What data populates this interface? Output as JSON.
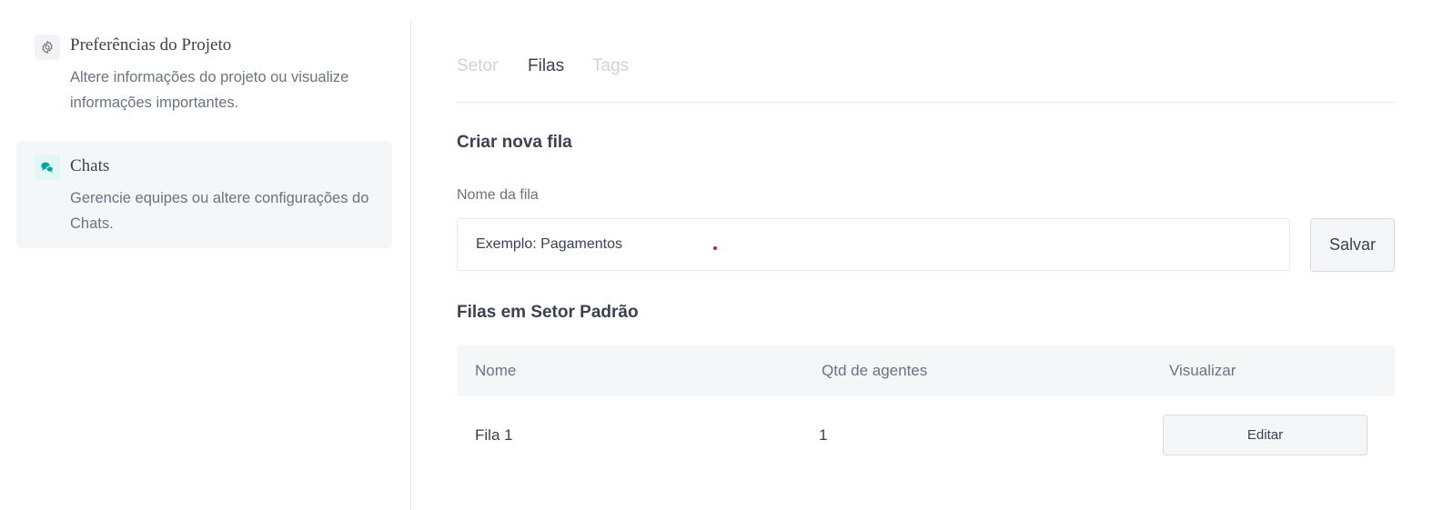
{
  "sidebar": {
    "items": [
      {
        "icon": "gear-icon",
        "title": "Preferências do Projeto",
        "description": "Altere informações do projeto ou visualize informações importantes."
      },
      {
        "icon": "chat-bubbles-icon",
        "title": "Chats",
        "description": "Gerencie equipes ou altere configurações do Chats.",
        "active": true
      }
    ]
  },
  "tabs": [
    {
      "label": "Setor",
      "active": false
    },
    {
      "label": "Filas",
      "active": true
    },
    {
      "label": "Tags",
      "active": false
    }
  ],
  "create_queue": {
    "title": "Criar nova fila",
    "field_label": "Nome da fila",
    "placeholder": "Exemplo: Pagamentos",
    "save_label": "Salvar"
  },
  "queues": {
    "title": "Filas em Setor Padrão",
    "columns": [
      "Nome",
      "Qtd de agentes",
      "Visualizar"
    ],
    "rows": [
      {
        "name": "Fila 1",
        "agents": "1",
        "action": "Editar"
      }
    ]
  },
  "colors": {
    "accent": "#00a49f",
    "text": "#3b4151",
    "muted": "#6b7280",
    "inactive_tab": "#cfd3dc",
    "surface": "#f4f6f8"
  }
}
